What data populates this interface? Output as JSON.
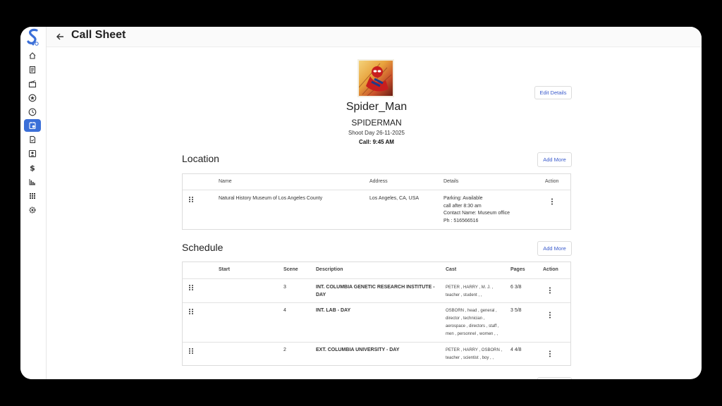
{
  "header": {
    "title": "Call Sheet"
  },
  "production": {
    "name": "Spider_Man",
    "title_upper": "SPIDERMAN",
    "shoot_day": "Shoot Day 26-11-2025",
    "call_time": "Call: 9:45 AM",
    "edit_label": "Edit Details"
  },
  "sidebar": {
    "items": [
      {
        "icon": "home-icon"
      },
      {
        "icon": "script-icon"
      },
      {
        "icon": "clapperboard-icon"
      },
      {
        "icon": "star-icon"
      },
      {
        "icon": "clock-icon"
      },
      {
        "icon": "call-sheet-icon",
        "active": true
      },
      {
        "icon": "document-icon"
      },
      {
        "icon": "contact-card-icon"
      },
      {
        "icon": "dollar-icon"
      },
      {
        "icon": "bar-chart-icon"
      },
      {
        "icon": "apps-grid-icon"
      },
      {
        "icon": "settings-icon"
      }
    ]
  },
  "location": {
    "heading": "Location",
    "add_label": "Add More",
    "columns": [
      "Name",
      "Address",
      "Details",
      "Action"
    ],
    "rows": [
      {
        "name": "Natural History Museum of Los Angeles County",
        "address": "Los Angeles, CA, USA",
        "details": [
          "Parking: Available",
          "call after 8:30 am",
          "Contact Name: Museum office",
          "Ph : 516566516"
        ]
      }
    ]
  },
  "schedule": {
    "heading": "Schedule",
    "add_label": "Add More",
    "columns": [
      "Start",
      "Scene",
      "Description",
      "Cast",
      "Pages",
      "Action"
    ],
    "rows": [
      {
        "start": "",
        "scene": "3",
        "description": [
          "INT. COLUMBIA GENETIC RESEARCH INSTITUTE -",
          "DAY"
        ],
        "cast": [
          "PETER , HARRY , M. J. ,",
          "teacher , student , ,"
        ],
        "pages": "6 3/8"
      },
      {
        "start": "",
        "scene": "4",
        "description": [
          "INT. LAB - DAY"
        ],
        "cast": [
          "OSBORN , head , general ,",
          "director , technician ,",
          "aerospace , directors , staff ,",
          "men , personnel , women , ,"
        ],
        "pages": "3 5/8"
      },
      {
        "start": "",
        "scene": "2",
        "description": [
          "EXT. COLUMBIA UNIVERSITY - DAY"
        ],
        "cast": [
          "PETER , HARRY , OSBORN ,",
          "teacher , scientist , boy , ,"
        ],
        "pages": "4 4/8"
      }
    ]
  },
  "colors": {
    "accent": "#3b6fd8",
    "link": "#3b5bcc"
  }
}
